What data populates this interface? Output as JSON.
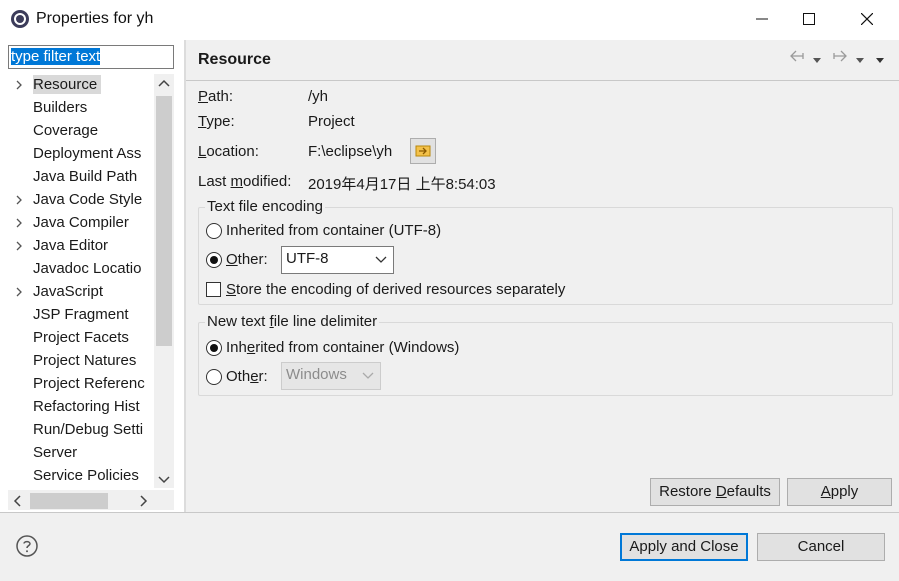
{
  "window": {
    "title": "Properties for yh"
  },
  "filter": {
    "value": "type filter text"
  },
  "tree": {
    "items": [
      {
        "label": "Resource",
        "expandable": true,
        "selected": true
      },
      {
        "label": "Builders",
        "expandable": false
      },
      {
        "label": "Coverage",
        "expandable": false
      },
      {
        "label": "Deployment Ass",
        "expandable": false
      },
      {
        "label": "Java Build Path",
        "expandable": false
      },
      {
        "label": "Java Code Style",
        "expandable": true
      },
      {
        "label": "Java Compiler",
        "expandable": true
      },
      {
        "label": "Java Editor",
        "expandable": true
      },
      {
        "label": "Javadoc Locatio",
        "expandable": false
      },
      {
        "label": "JavaScript",
        "expandable": true
      },
      {
        "label": "JSP Fragment",
        "expandable": false
      },
      {
        "label": "Project Facets",
        "expandable": false
      },
      {
        "label": "Project Natures",
        "expandable": false
      },
      {
        "label": "Project Referenc",
        "expandable": false
      },
      {
        "label": "Refactoring Hist",
        "expandable": false
      },
      {
        "label": "Run/Debug Setti",
        "expandable": false
      },
      {
        "label": "Server",
        "expandable": false
      },
      {
        "label": "Service Policies",
        "expandable": false
      }
    ]
  },
  "page": {
    "title": "Resource",
    "path_label_pre": "",
    "path_label_u": "P",
    "path_label_post": "ath:",
    "path_value": "/yh",
    "type_label_pre": "",
    "type_label_u": "T",
    "type_label_post": "ype:",
    "type_value": "Project",
    "location_label_pre": "",
    "location_label_u": "L",
    "location_label_post": "ocation:",
    "location_value": "F:\\eclipse\\yh",
    "modified_label_pre": "Last ",
    "modified_label_u": "m",
    "modified_label_post": "odified:",
    "modified_value": "2019年4月17日 上午8:54:03"
  },
  "encoding": {
    "group_title": "Text file encoding",
    "inherited_label": "Inherited from container (UTF-8)",
    "other_label_u": "O",
    "other_label_post": "ther:",
    "other_value": "UTF-8",
    "store_label_pre": "",
    "store_label_u": "S",
    "store_label_post": "tore the encoding of derived resources separately"
  },
  "delimiter": {
    "group_title_pre": "New text ",
    "group_title_u": "f",
    "group_title_post": "ile line delimiter",
    "inherited_label_pre": "Inh",
    "inherited_label_u": "e",
    "inherited_label_post": "rited from container (Windows)",
    "other_label_pre": "Oth",
    "other_label_u": "e",
    "other_label_post": "r:",
    "other_value": "Windows"
  },
  "buttons": {
    "restore_pre": "Restore ",
    "restore_u": "D",
    "restore_post": "efaults",
    "apply_pre": "",
    "apply_u": "A",
    "apply_post": "pply",
    "apply_close": "Apply and Close",
    "cancel": "Cancel"
  },
  "colors": {
    "selection": "#0078d7",
    "dialog_bg": "#f0f0f0"
  }
}
